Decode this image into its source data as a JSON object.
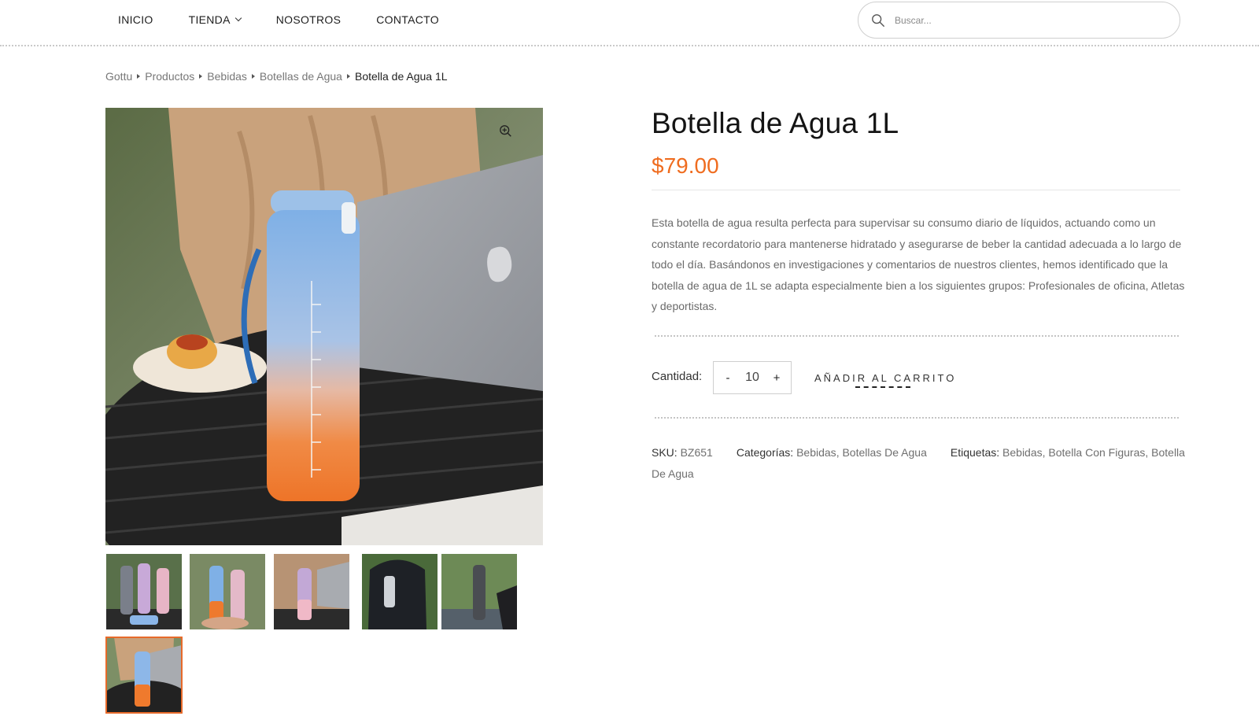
{
  "nav": {
    "items": [
      {
        "label": "INICIO"
      },
      {
        "label": "TIENDA",
        "has_dropdown": true
      },
      {
        "label": "NOSOTROS"
      },
      {
        "label": "CONTACTO"
      }
    ]
  },
  "search": {
    "placeholder": "Buscar..."
  },
  "breadcrumb": [
    "Gottu",
    "Productos",
    "Bebidas",
    "Botellas de Agua",
    "Botella de Agua 1L"
  ],
  "product": {
    "title": "Botella de Agua 1L",
    "price": "$79.00",
    "description": "Esta botella de agua resulta perfecta para supervisar su consumo diario de líquidos, actuando como un constante recordatorio para mantenerse hidratado y asegurarse de beber la cantidad adecuada a lo largo de todo el día. Basándonos en investigaciones y comentarios de nuestros clientes, hemos identificado que la botella de agua de 1L se adapta especialmente bien a los siguientes grupos: Profesionales de oficina, Atletas y deportistas.",
    "quantity_label": "Cantidad:",
    "quantity_value": "10",
    "minus_label": "-",
    "plus_label": "+",
    "add_to_cart": "AÑADIR AL CARRITO",
    "sku_label": "SKU:",
    "sku_value": "BZ651",
    "categories_label": "Categorías:",
    "categories": [
      "Bebidas",
      "Botellas De Agua"
    ],
    "tags_label": "Etiquetas:",
    "tags": [
      "Bebidas",
      "Botella Con Figuras",
      "Botella De Agua"
    ]
  },
  "gallery": {
    "thumbnail_count": 6,
    "active_index": 5
  },
  "colors": {
    "accent": "#ef6c1f",
    "active_thumb_border": "#e76a2a"
  }
}
